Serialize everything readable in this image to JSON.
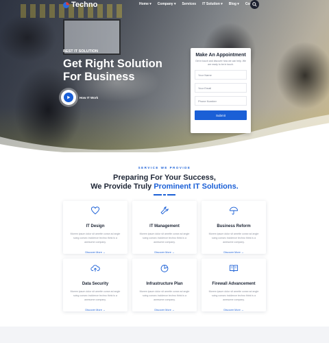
{
  "brand": {
    "name": "Techno"
  },
  "nav": {
    "items": [
      "Home ▾",
      "Company ▾",
      "Services",
      "IT Solution ▾",
      "Blog ▾",
      "Contact"
    ]
  },
  "hero": {
    "eyebrow": "BEST IT SOLUTION",
    "headline_line1": "Get Right Solution",
    "headline_line2": "For Business",
    "video_label": "How IT Work"
  },
  "appointment": {
    "title": "Make An Appointment",
    "description": "Get in touch and discover how we can help. We are ready to be in touch.",
    "name_placeholder": "Your Name",
    "email_placeholder": "Your Email",
    "phone_placeholder": "Phone Number",
    "submit_label": "Submit"
  },
  "services": {
    "eyebrow": "SERVICE WE PROVIDE",
    "title_line1": "Preparing For Your Success,",
    "title_line2_prefix": "We Provide Truly ",
    "title_line2_accent": "Prominent IT Solutions.",
    "items": [
      {
        "title": "IT Design",
        "icon": "heart-icon",
        "text": "Morem ipsum dolor sit amette conse ad angle scing consec incidence techno think is a awesome company.",
        "link": "Discover More →"
      },
      {
        "title": "IT Management",
        "icon": "wrench-icon",
        "text": "Morem ipsum dolor sit amette conse ad angle scing consec incidence techno think is a awesome company.",
        "link": "Discover More →"
      },
      {
        "title": "Business Reform",
        "icon": "umbrella-icon",
        "text": "Morem ipsum dolor sit amette conse ad angle scing consec incidence techno think is a awesome company.",
        "link": "Discover More →"
      },
      {
        "title": "Data Security",
        "icon": "cloud-upload-icon",
        "text": "Morem ipsum dolor sit amette conse ad angle scing consec incidence techno think is a awesome company.",
        "link": "Discover More →"
      },
      {
        "title": "Infrastructure Plan",
        "icon": "pie-chart-icon",
        "text": "Morem ipsum dolor sit amette conse ad angle scing consec incidence techno think is a awesome company.",
        "link": "Discover More →"
      },
      {
        "title": "Firewall Advancement",
        "icon": "book-icon",
        "text": "Morem ipsum dolor sit amette conse ad angle scing consec incidence techno think is a awesome company.",
        "link": "Discover More →"
      }
    ]
  },
  "colors": {
    "accent": "#1a5fd6",
    "heading": "#1c2434",
    "muted": "#8b909c"
  }
}
